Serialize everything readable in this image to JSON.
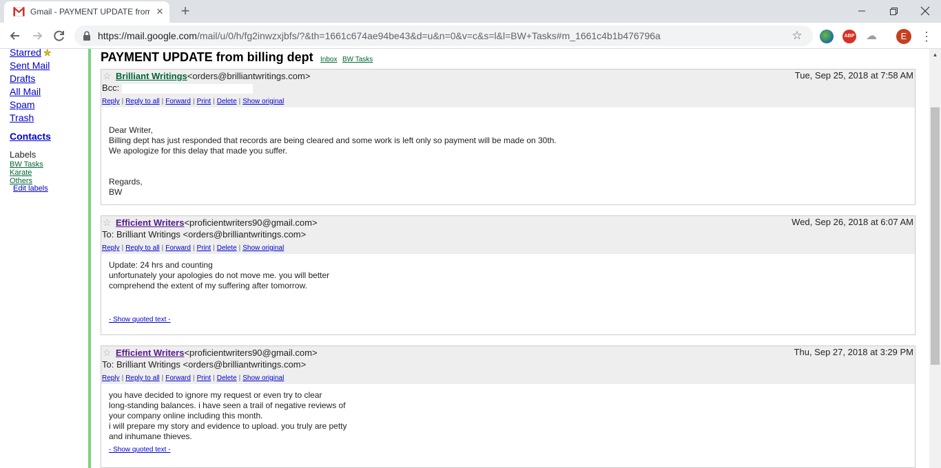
{
  "browser": {
    "tab_title": "Gmail - PAYMENT UPDATE from billing dept",
    "tab_close": "✕",
    "new_tab": "+",
    "url_host": "https://mail.google.com",
    "url_path": "/mail/u/0/h/fg2inwzxjbfs/?&th=1661c674ae94be43&d=u&n=0&v=c&s=l&l=BW+Tasks#m_1661c4b1b476796a",
    "avatar_letter": "E",
    "ext_abp": "ABP"
  },
  "sidebar": {
    "items": [
      "Starred",
      "Sent Mail",
      "Drafts",
      "All Mail",
      "Spam",
      "Trash"
    ],
    "contacts": "Contacts",
    "labels_heading": "Labels",
    "labels": [
      "BW Tasks",
      "Karate",
      "Others"
    ],
    "edit_labels": "Edit labels"
  },
  "thread": {
    "subject": "PAYMENT UPDATE from billing dept",
    "labels": [
      "Inbox",
      "BW Tasks"
    ]
  },
  "actions": [
    "Reply",
    "Reply to all",
    "Forward",
    "Print",
    "Delete",
    "Show original"
  ],
  "messages": [
    {
      "from_name": "Brilliant Writings",
      "from_email": "<orders@brilliantwritings.com>",
      "date": "Tue, Sep 25, 2018 at 7:58 AM",
      "recipient_line": "Bcc:",
      "body": [
        "Dear Writer,",
        "Billing dept has just responded that records are being cleared and some work is left only so payment will be made on 30th.",
        "We apologize for this delay that made you suffer.",
        "",
        "",
        "Regards,",
        "BW"
      ]
    },
    {
      "from_name": "Efficient Writers",
      "from_email": "<proficientwriters90@gmail.com>",
      "date": "Wed, Sep 26, 2018 at 6:07 AM",
      "recipient_line": "To: Brilliant Writings <orders@brilliantwritings.com>",
      "body": [
        "Update: 24 hrs and counting",
        "unfortunately your apologies do not move me. you will better",
        "comprehend the extent of my suffering after tomorrow."
      ],
      "quoted": "- Show quoted text -"
    },
    {
      "from_name": "Efficient Writers",
      "from_email": "<proficientwriters90@gmail.com>",
      "date": "Thu, Sep 27, 2018 at 3:29 PM",
      "recipient_line": "To: Brilliant Writings <orders@brilliantwritings.com>",
      "body": [
        "you have decided to ignore my request or even try to clear",
        "long-standing balances. i have seen a trail of negative reviews of",
        "your company online including this month.",
        "i will prepare my story and evidence to upload. you truly are petty",
        "and inhumane thieves."
      ],
      "quoted": "- Show quoted text -"
    }
  ]
}
